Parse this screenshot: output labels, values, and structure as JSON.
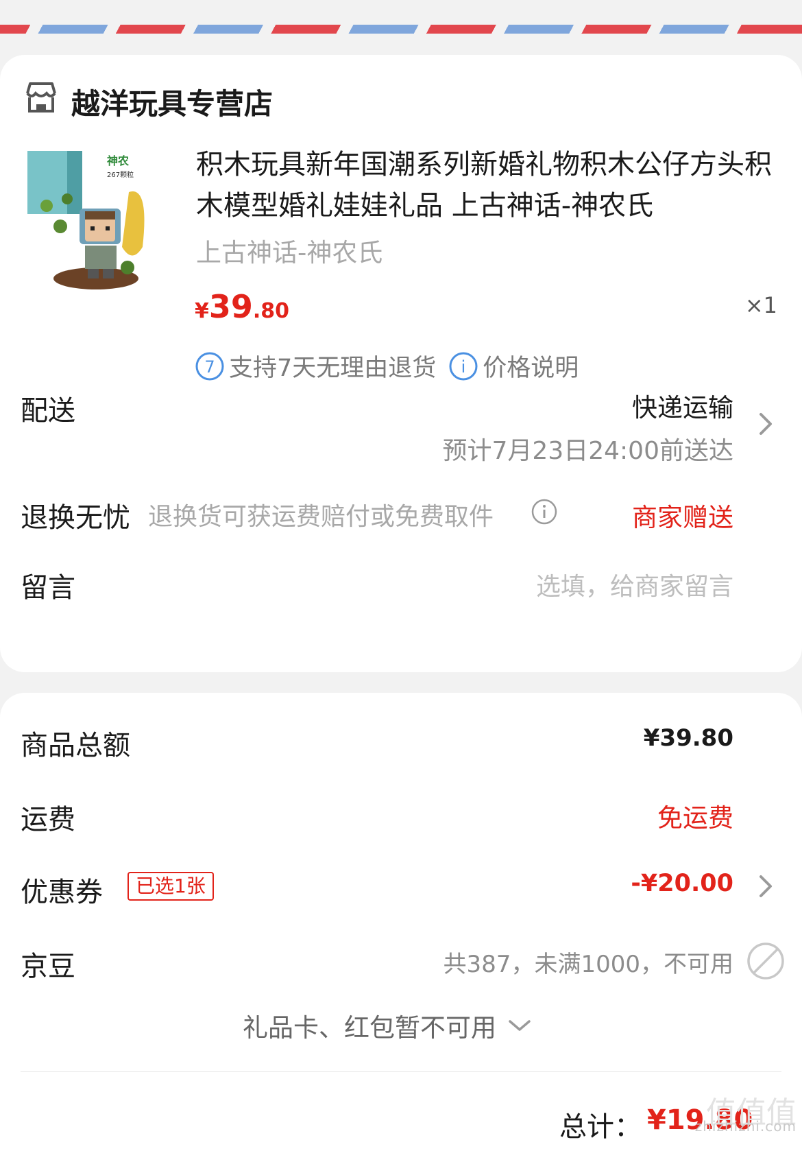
{
  "store": {
    "name": "越洋玩具专营店",
    "icon": "store-icon"
  },
  "product": {
    "title": "积木玩具新年国潮系列新婚礼物积木公仔方头积木模型婚礼娃娃礼品 上古神话-神农氏",
    "variant": "上古神话-神农氏",
    "box_label": "神农",
    "box_sub": "267颗粒",
    "price_symbol": "¥",
    "price_int": "39",
    "price_dec": ".80",
    "quantity": "×1",
    "badges": [
      {
        "icon": "seven-day-return-icon",
        "glyph": "7",
        "label": "支持7天无理由退货"
      },
      {
        "icon": "info-icon",
        "glyph": "i",
        "label": "价格说明"
      }
    ]
  },
  "delivery": {
    "label": "配送",
    "method": "快递运输",
    "eta": "预计7月23日24:00前送达"
  },
  "returns": {
    "label": "退换无忧",
    "hint": "退换货可获运费赔付或免费取件",
    "value": "商家赠送"
  },
  "message": {
    "label": "留言",
    "placeholder": "选填，给商家留言"
  },
  "summary": {
    "goods_total_label": "商品总额",
    "goods_total": "¥39.80",
    "shipping_label": "运费",
    "shipping_value": "免运费",
    "coupon_label": "优惠券",
    "coupon_tag": "已选1张",
    "coupon_value": "-¥20.00",
    "jingdou_label": "京豆",
    "jingdou_value": "共387，未满1000，不可用",
    "gift_card_note": "礼品卡、红包暂不可用",
    "total_label": "总计：",
    "total_value": "¥19.80"
  },
  "watermark": {
    "text": "值值值",
    "sub": "zhizhizhi.com"
  },
  "colors": {
    "accent": "#e2231a",
    "stripe_red": "#e2474d",
    "stripe_blue": "#7fa6dc",
    "badge_blue": "#4a90e2"
  }
}
